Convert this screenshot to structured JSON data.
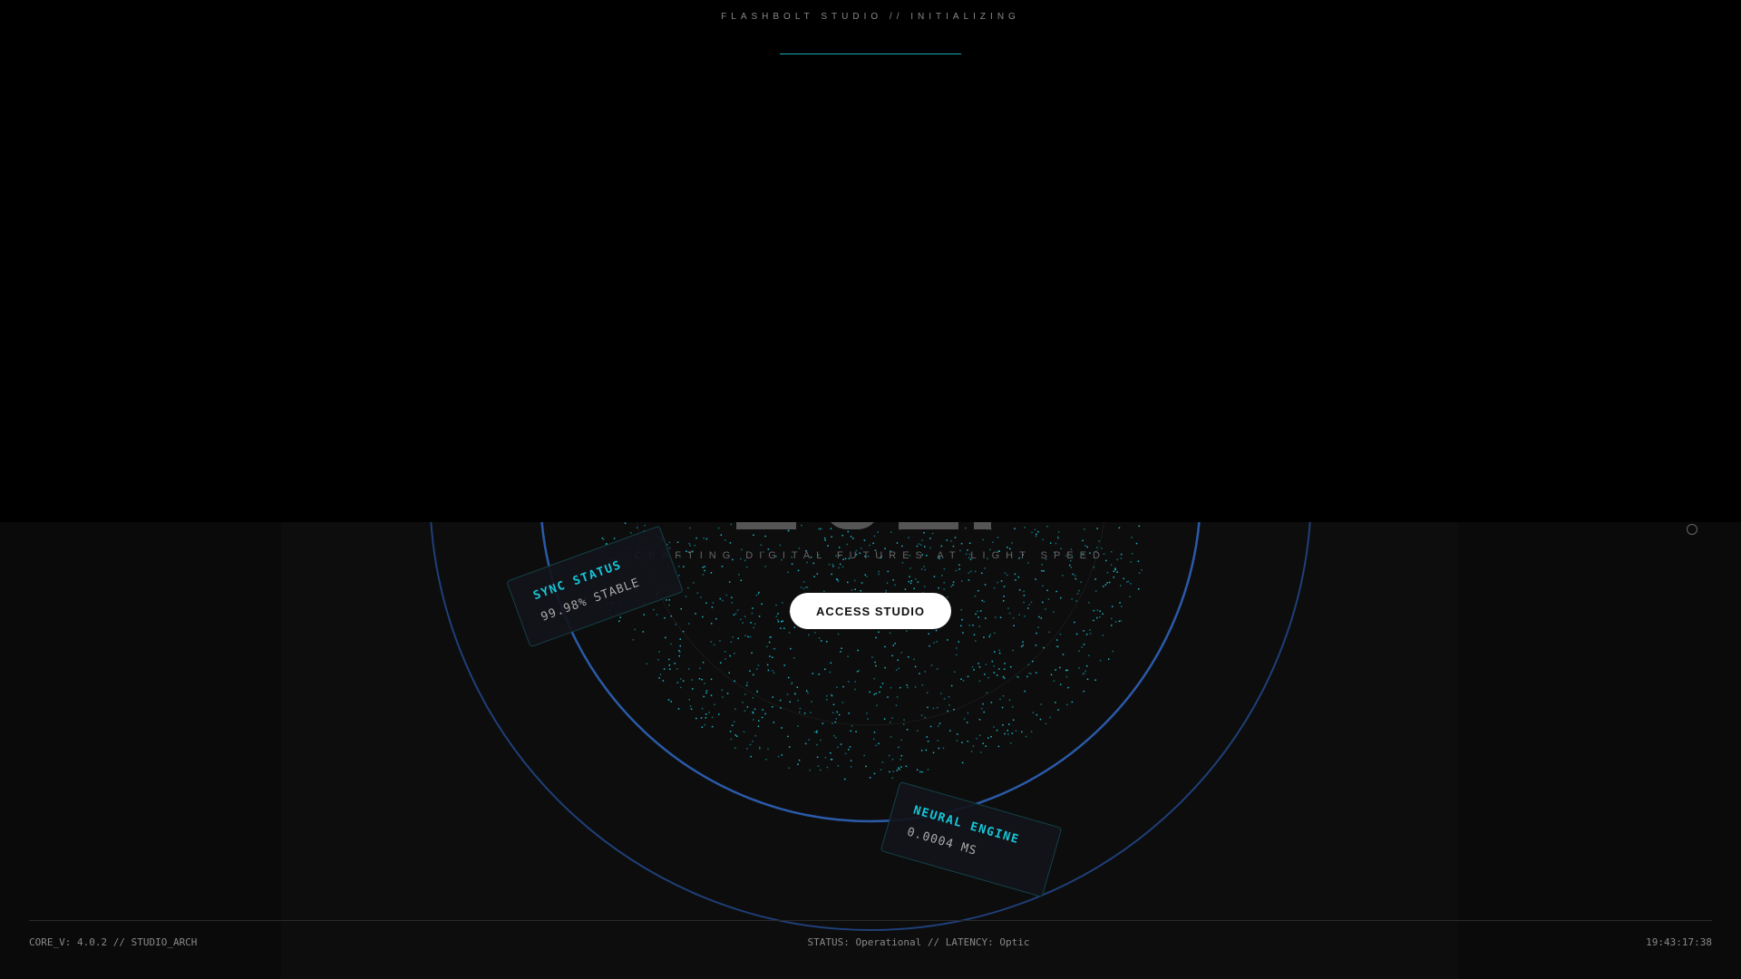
{
  "header": {
    "title": "FLASHBOLT STUDIO // INITIALIZING",
    "progress_percent": 100
  },
  "hero": {
    "tagline": "CRAFTING DIGITAL FUTURES AT LIGHT SPEED",
    "cta_label": "ACCESS STUDIO"
  },
  "cards": [
    {
      "title": "SYNC STATUS",
      "value": "99.98% STABLE"
    },
    {
      "title": "NEURAL ENGINE",
      "value": "0.0004 MS"
    }
  ],
  "footer": {
    "left": "CORE_V: 4.0.2 // STUDIO_ARCH",
    "center": "STATUS: Operational // LATENCY: Optic",
    "right": "19:43:17:38"
  },
  "colors": {
    "accent": "#16c7d8",
    "ring": "#2a5aa8",
    "background": "#0a0a0a"
  }
}
